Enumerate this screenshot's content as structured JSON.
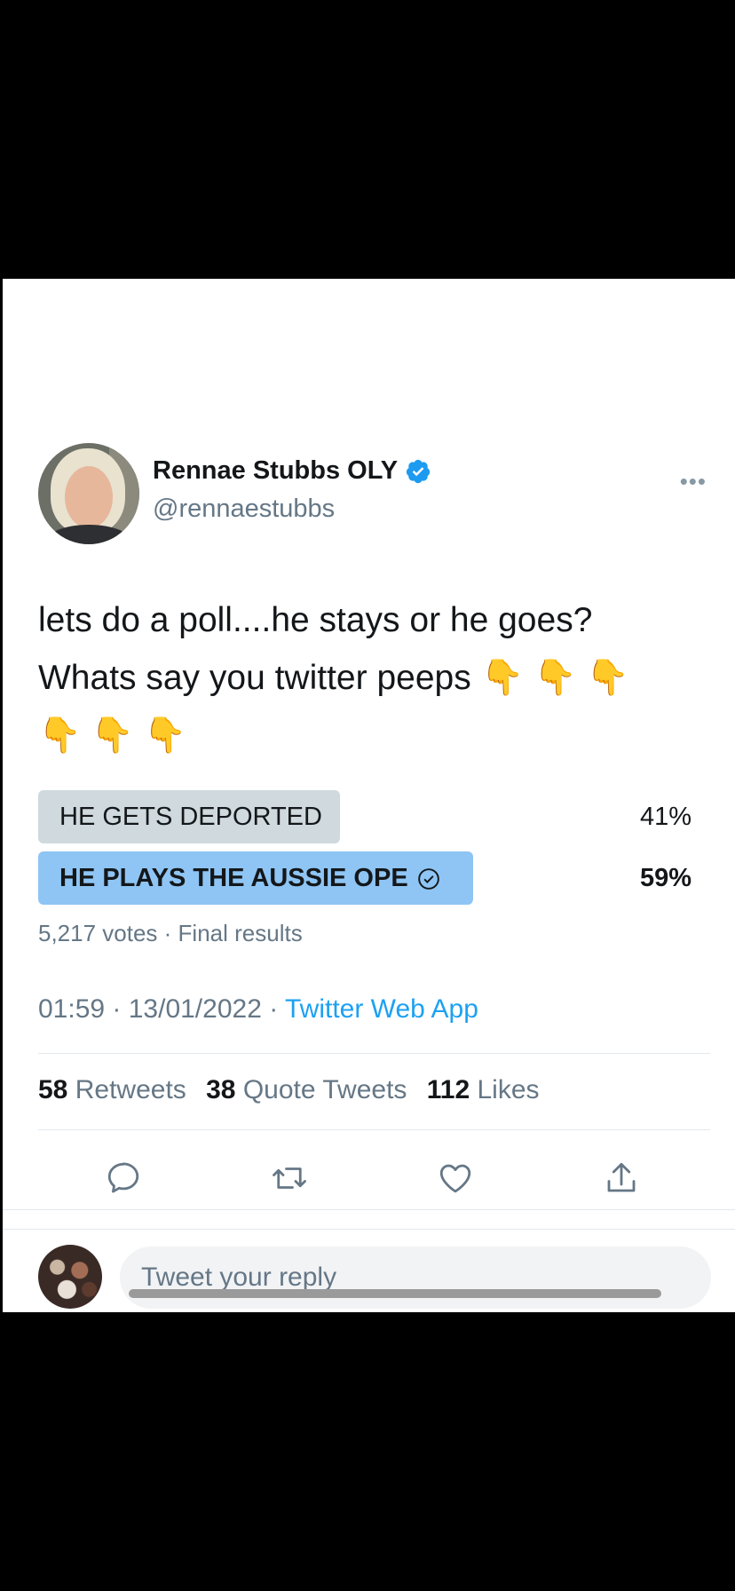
{
  "tweet": {
    "author_name": "Rennae Stubbs OLY",
    "handle": "@rennaestubbs",
    "text_line1": "lets do a poll....he stays or he goes?",
    "text_line2": "Whats say you twitter peeps 👇 👇 👇",
    "text_line3": "👇 👇 👇",
    "more_label": "•••"
  },
  "poll": {
    "options": [
      {
        "label": "HE GETS DEPORTED",
        "percent_label": "41%",
        "percent": 41,
        "winner": false
      },
      {
        "label": "HE PLAYS THE AUSSIE OPE",
        "percent_label": "59%",
        "percent": 59,
        "winner": true
      }
    ],
    "meta": "5,217 votes · Final results",
    "colors": {
      "winner": "#8ec5f4",
      "other": "#cfd9de"
    }
  },
  "timestamp": "01:59 · 13/01/2022 · ",
  "source_app": "Twitter Web App",
  "stats": {
    "retweets": {
      "count": "58",
      "label": "Retweets"
    },
    "quotes": {
      "count": "38",
      "label": "Quote Tweets"
    },
    "likes": {
      "count": "112",
      "label": "Likes"
    }
  },
  "actions": [
    "reply-icon",
    "retweet-icon",
    "like-icon",
    "share-icon"
  ],
  "reply": {
    "placeholder": "Tweet your reply"
  },
  "colors": {
    "accent": "#1da1f2",
    "verified": "#1d9bf0",
    "secondary_text": "#657786"
  }
}
